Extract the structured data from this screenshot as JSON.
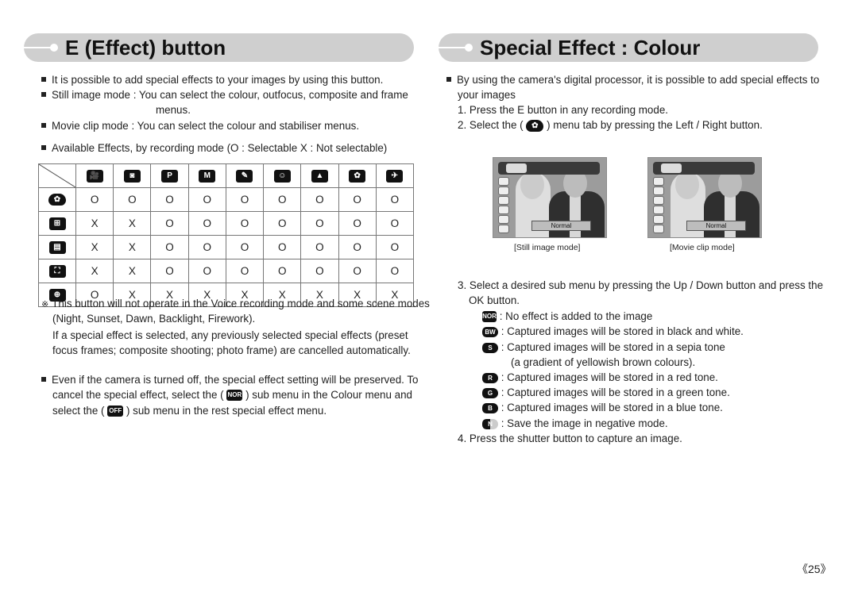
{
  "left": {
    "title": "E (Effect) button",
    "bullets": [
      "It is possible to add special effects to your images by using this button.",
      "Still image mode : You can select the colour, outfocus, composite and frame",
      "menus.",
      "Movie clip mode : You can select the colour and stabiliser menus.",
      "Available Effects, by recording mode (O : Selectable X : Not selectable)"
    ],
    "table": {
      "column_icons": [
        "movie-clip-mode",
        "auto-mode",
        "program-mode",
        "manual-mode",
        "scene-mode",
        "portrait-mode",
        "landscape-mode",
        "macro-mode",
        "sports-mode"
      ],
      "column_glyphs": [
        "🎥",
        "◙",
        "P",
        "M",
        "✎",
        "☺",
        "▲",
        "✿",
        "✈"
      ],
      "rows": [
        {
          "icon": "colour-effect",
          "glyph": "✿",
          "values": [
            "O",
            "O",
            "O",
            "O",
            "O",
            "O",
            "O",
            "O",
            "O"
          ]
        },
        {
          "icon": "preset-focus-frame",
          "glyph": "⊞",
          "values": [
            "X",
            "X",
            "O",
            "O",
            "O",
            "O",
            "O",
            "O",
            "O"
          ]
        },
        {
          "icon": "composite-shooting",
          "glyph": "▤",
          "values": [
            "X",
            "X",
            "O",
            "O",
            "O",
            "O",
            "O",
            "O",
            "O"
          ]
        },
        {
          "icon": "photo-frame",
          "glyph": "⛶",
          "values": [
            "X",
            "X",
            "O",
            "O",
            "O",
            "O",
            "O",
            "O",
            "O"
          ]
        },
        {
          "icon": "stabiliser",
          "glyph": "⊕",
          "values": [
            "O",
            "X",
            "X",
            "X",
            "X",
            "X",
            "X",
            "X",
            "X"
          ]
        }
      ]
    },
    "note_mark": "※",
    "note_lines": [
      "This button will not operate in the Voice recording mode and some scene modes",
      "(Night, Sunset, Dawn, Backlight, Firework).",
      "If a special effect is selected, any previously selected special effects (preset",
      "focus frames; composite shooting; photo frame) are cancelled automatically."
    ],
    "final_bullet": {
      "line1": "Even if the camera is turned off, the special effect setting will be preserved. To",
      "line2_pre": "cancel the special effect, select the (",
      "line2_icon": "NOR",
      "line2_post": ") sub menu in the Colour menu and",
      "line3_pre": "select the (",
      "line3_icon": "OFF",
      "line3_post": ") sub menu in the rest special effect menu."
    }
  },
  "right": {
    "title": "Special Effect : Colour",
    "intro_line1": "By using the camera's digital processor, it is possible to add special effects to",
    "intro_line2": "your images",
    "step1": "1. Press the E button in any recording mode.",
    "step2_pre": "2. Select the (",
    "step2_post": ") menu tab by pressing the Left / Right button.",
    "previews": [
      {
        "caption": "[Still image mode]",
        "label": "Normal"
      },
      {
        "caption": "[Movie clip mode]",
        "label": "Normal"
      }
    ],
    "step3_line1": "3. Select a desired sub menu by pressing the Up / Down button and press the",
    "step3_line2": "OK button.",
    "options": [
      {
        "icon": "NOR",
        "text": ": No effect is added to the image"
      },
      {
        "icon": "BW",
        "text": ": Captured images will be stored in black and white."
      },
      {
        "icon": "S",
        "text": ": Captured images will be stored in a sepia tone"
      },
      {
        "icon": "",
        "text": "(a gradient of yellowish brown colours)."
      },
      {
        "icon": "R",
        "text": ": Captured images will be stored in a red tone."
      },
      {
        "icon": "G",
        "text": ": Captured images will be stored in a green tone."
      },
      {
        "icon": "B",
        "text": ": Captured images will be stored in a blue tone."
      },
      {
        "icon": "N",
        "text": ": Save the image in negative mode."
      }
    ],
    "step4": "4. Press the shutter button to capture an image."
  },
  "page_number": "《25》"
}
